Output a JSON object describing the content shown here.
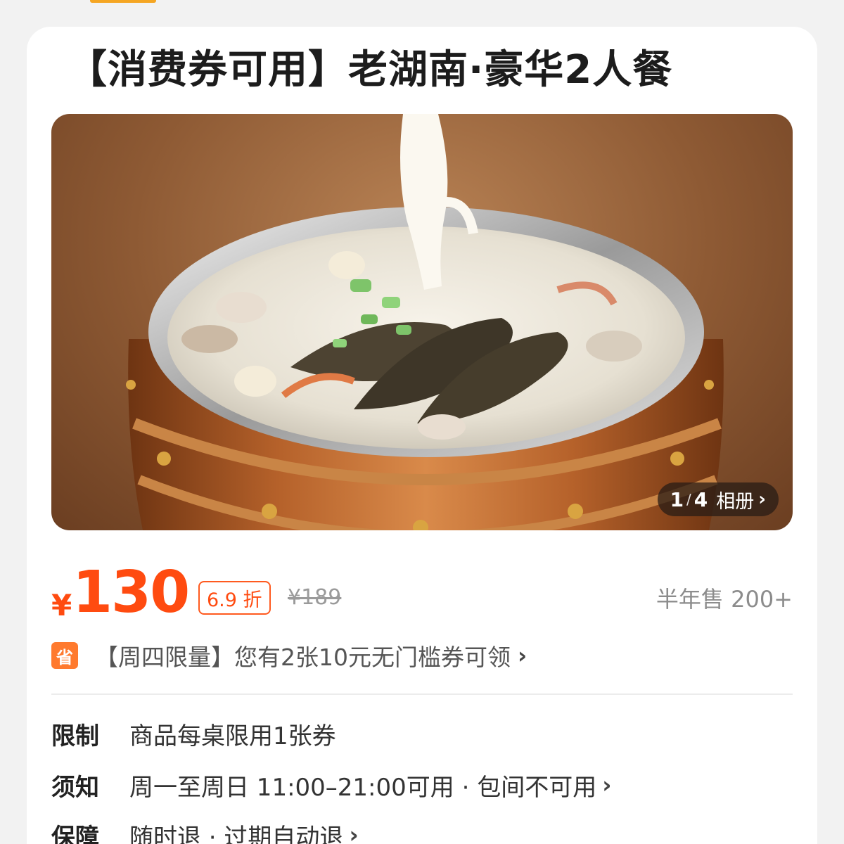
{
  "title": "【消费券可用】老湖南·豪华2人餐",
  "gallery": {
    "current": "1",
    "separator": "/",
    "total": "4",
    "album_label": "相册",
    "image_desc_icon": "seafood-hotpot-barrel-photo"
  },
  "price": {
    "currency": "¥",
    "amount": "130",
    "discount": "6.9 折",
    "original": "¥189",
    "sold": "半年售 200+"
  },
  "coupon": {
    "icon_label": "省",
    "text": "【周四限量】您有2张10元无门槛券可领"
  },
  "info": [
    {
      "label": "限制",
      "value": "商品每桌限用1张券",
      "has_chevron": false
    },
    {
      "label": "须知",
      "value": "周一至周日 11:00–21:00可用 · 包间不可用",
      "has_chevron": true
    },
    {
      "label": "保障",
      "value": "随时退 · 过期自动退",
      "has_chevron": true
    }
  ],
  "colors": {
    "accent": "#ff4b10",
    "coupon_icon": "#ff7a2e",
    "background": "#f2f2f2"
  }
}
